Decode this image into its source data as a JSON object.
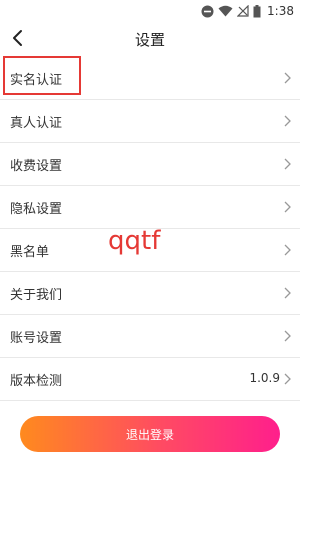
{
  "status_bar": {
    "time": "1:38"
  },
  "header": {
    "title": "设置"
  },
  "settings": {
    "items": [
      {
        "label": "实名认证"
      },
      {
        "label": "真人认证"
      },
      {
        "label": "收费设置"
      },
      {
        "label": "隐私设置"
      },
      {
        "label": "黑名单"
      },
      {
        "label": "关于我们"
      },
      {
        "label": "账号设置"
      },
      {
        "label": "版本检测",
        "value": "1.0.9"
      }
    ]
  },
  "watermark": "qqtf",
  "logout": {
    "label": "退出登录"
  },
  "colors": {
    "highlight_box": "#e53935",
    "watermark": "#e53935",
    "button_gradient_start": "#ff8a1e",
    "button_gradient_end": "#ff1f8c",
    "divider": "#e8e8e8"
  }
}
